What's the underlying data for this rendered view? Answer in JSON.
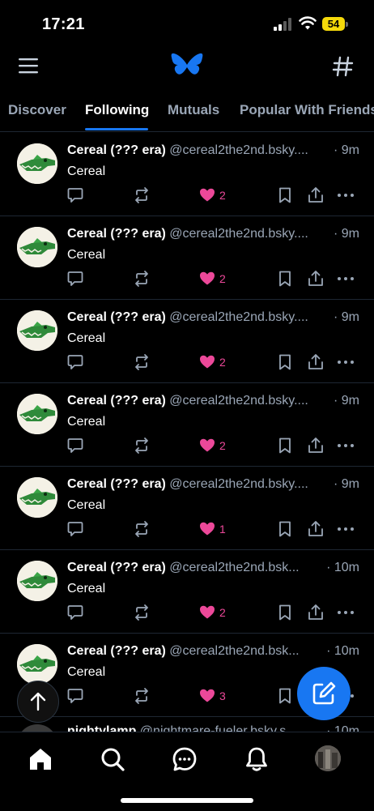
{
  "status_bar": {
    "time": "17:21",
    "battery_level": "54"
  },
  "header": {
    "menu_icon": "hamburger-menu-icon",
    "logo_icon": "butterfly-logo-icon",
    "feeds_icon": "hashtag-icon",
    "accent_color": "#1877f2"
  },
  "tabs": [
    {
      "label": "Discover",
      "active": false
    },
    {
      "label": "Following",
      "active": true
    },
    {
      "label": "Mutuals",
      "active": false
    },
    {
      "label": "Popular With Friends",
      "active": false
    }
  ],
  "posts": [
    {
      "name": "Cereal (??? era)",
      "handle": "@cereal2the2nd.bsky....",
      "time": "· 9m",
      "text": "Cereal",
      "likes": "2"
    },
    {
      "name": "Cereal (??? era)",
      "handle": "@cereal2the2nd.bsky....",
      "time": "· 9m",
      "text": "Cereal",
      "likes": "2"
    },
    {
      "name": "Cereal (??? era)",
      "handle": "@cereal2the2nd.bsky....",
      "time": "· 9m",
      "text": "Cereal",
      "likes": "2"
    },
    {
      "name": "Cereal (??? era)",
      "handle": "@cereal2the2nd.bsky....",
      "time": "· 9m",
      "text": "Cereal",
      "likes": "2"
    },
    {
      "name": "Cereal (??? era)",
      "handle": "@cereal2the2nd.bsky....",
      "time": "· 9m",
      "text": "Cereal",
      "likes": "1"
    },
    {
      "name": "Cereal (??? era)",
      "handle": "@cereal2the2nd.bsk...",
      "time": "· 10m",
      "text": "Cereal",
      "likes": "2"
    },
    {
      "name": "Cereal (??? era)",
      "handle": "@cereal2the2nd.bsk...",
      "time": "· 10m",
      "text": "Cereal",
      "likes": "3"
    }
  ],
  "partial_post": {
    "name": "nightylamp",
    "handle": "@nightmare-fueler.bsky.s...",
    "time": "· 10m"
  },
  "like_color": "#ec4899",
  "bottom_nav": [
    {
      "icon": "home-icon",
      "active": true
    },
    {
      "icon": "search-icon",
      "active": false
    },
    {
      "icon": "chat-icon",
      "active": false
    },
    {
      "icon": "bell-icon",
      "active": false
    },
    {
      "icon": "profile-avatar",
      "active": false
    }
  ]
}
